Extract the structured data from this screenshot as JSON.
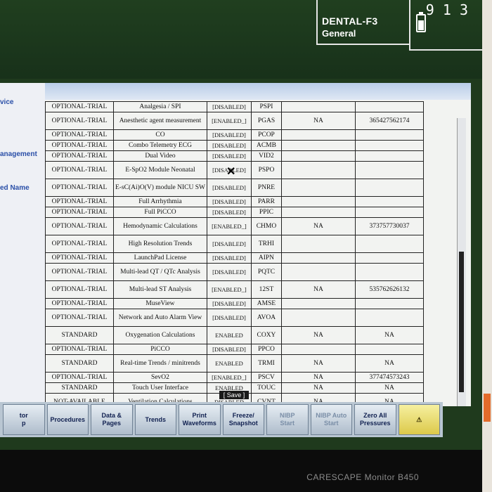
{
  "header": {
    "patient_name": "DENTAL-F3",
    "patient_type": "General",
    "bed_number": "9 1 3"
  },
  "left_panel": {
    "items": [
      "vice",
      "anagement",
      "ed Name"
    ]
  },
  "table": {
    "rows": [
      [
        "OPTIONAL-TRIAL",
        "Analgesia / SPI",
        "[DISABLED]",
        "PSPI",
        "",
        ""
      ],
      [
        "OPTIONAL-TRIAL",
        "Anesthetic agent measurement",
        "[ENABLED_]",
        "PGAS",
        "NA",
        "365427562174"
      ],
      [
        "OPTIONAL-TRIAL",
        "CO",
        "[DISABLED]",
        "PCOP",
        "",
        ""
      ],
      [
        "OPTIONAL-TRIAL",
        "Combo Telemetry ECG",
        "[DISABLED]",
        "ACMB",
        "",
        ""
      ],
      [
        "OPTIONAL-TRIAL",
        "Dual Video",
        "[DISABLED]",
        "VID2",
        "",
        ""
      ],
      [
        "OPTIONAL-TRIAL",
        "E-SpO2 Module Neonatal",
        "[DISABLED]",
        "PSPO",
        "",
        ""
      ],
      [
        "OPTIONAL-TRIAL",
        "E-sC(Ai)O(V) module NICU SW",
        "[DISABLED]",
        "PNRE",
        "",
        ""
      ],
      [
        "OPTIONAL-TRIAL",
        "Full Arrhythmia",
        "[DISABLED]",
        "PARR",
        "",
        ""
      ],
      [
        "OPTIONAL-TRIAL",
        "Full PiCCO",
        "[DISABLED]",
        "PPIC",
        "",
        ""
      ],
      [
        "OPTIONAL-TRIAL",
        "Hemodynamic Calculations",
        "[ENABLED_]",
        "CHMO",
        "NA",
        "373757730037"
      ],
      [
        "OPTIONAL-TRIAL",
        "High Resolution Trends",
        "[DISABLED]",
        "TRHI",
        "",
        ""
      ],
      [
        "OPTIONAL-TRIAL",
        "LaunchPad License",
        "[DISABLED]",
        "AIPN",
        "",
        ""
      ],
      [
        "OPTIONAL-TRIAL",
        "Multi-lead QT / QTc Analysis",
        "[DISABLED]",
        "PQTC",
        "",
        ""
      ],
      [
        "OPTIONAL-TRIAL",
        "Multi-lead ST Analysis",
        "[ENABLED_]",
        "12ST",
        "NA",
        "535762626132"
      ],
      [
        "OPTIONAL-TRIAL",
        "MuseView",
        "[DISABLED]",
        "AMSE",
        "",
        ""
      ],
      [
        "OPTIONAL-TRIAL",
        "Network and Auto Alarm View",
        "[DISABLED]",
        "AVOA",
        "",
        ""
      ],
      [
        "STANDARD",
        "Oxygenation Calculations",
        "ENABLED",
        "COXY",
        "NA",
        "NA"
      ],
      [
        "OPTIONAL-TRIAL",
        "PiCCO",
        "[DISABLED]",
        "PPCO",
        "",
        ""
      ],
      [
        "STANDARD",
        "Real-time Trends / minitrends",
        "ENABLED",
        "TRMI",
        "NA",
        "NA"
      ],
      [
        "OPTIONAL-TRIAL",
        "SevO2",
        "[ENABLED_]",
        "PSCV",
        "NA",
        "377474573243"
      ],
      [
        "STANDARD",
        "Touch User Interface",
        "ENABLED",
        "TOUC",
        "NA",
        "NA"
      ],
      [
        "NOT-AVAILABLE",
        "Ventilation Calculations",
        "DISABLED",
        "CVNT",
        "NA",
        "NA"
      ]
    ]
  },
  "save_label": "[ Save ]",
  "bottom_bar": {
    "buttons": [
      "tor\np",
      "Procedures",
      "Data &\nPages",
      "Trends",
      "Print\nWaveforms",
      "Freeze/\nSnapshot",
      "NIBP\nStart",
      "NIBP Auto\nStart",
      "Zero All\nPressures",
      "⚠"
    ]
  },
  "model_text": "CARESCAPE Monitor B450"
}
